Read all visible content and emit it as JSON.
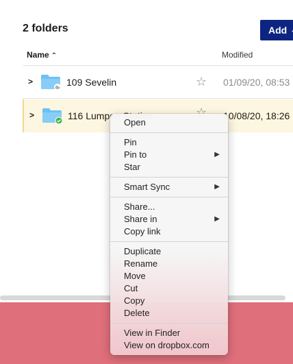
{
  "header": {
    "title": "2 folders",
    "add_label": "Add",
    "add_chevron": "⌄"
  },
  "columns": {
    "name": "Name",
    "name_sort": "⌃",
    "modified": "Modified"
  },
  "rows": [
    {
      "name": "109 Sevelin",
      "modified": "01/09/20, 08:53",
      "starred": false,
      "status": "cloud"
    },
    {
      "name": "116 Lumpen Station",
      "modified": "10/08/20, 18:26",
      "starred": false,
      "status": "synced"
    }
  ],
  "context_menu": {
    "groups": [
      [
        {
          "label": "Open"
        }
      ],
      [
        {
          "label": "Pin"
        },
        {
          "label": "Pin to",
          "submenu": "▶"
        },
        {
          "label": "Star"
        }
      ],
      [
        {
          "label": "Smart Sync",
          "submenu": "▶"
        }
      ],
      [
        {
          "label": "Share..."
        },
        {
          "label": "Share in",
          "submenu": "▶"
        },
        {
          "label": "Copy link"
        }
      ],
      [
        {
          "label": "Duplicate"
        },
        {
          "label": "Rename"
        },
        {
          "label": "Move"
        },
        {
          "label": "Cut"
        },
        {
          "label": "Copy"
        },
        {
          "label": "Delete"
        }
      ],
      [
        {
          "label": "View in Finder"
        },
        {
          "label": "View on dropbox.com"
        }
      ]
    ]
  },
  "icons": {
    "expand": "chevron-right-icon",
    "star": "star-icon",
    "folder": "folder-icon",
    "cloud_badge": "cloud-icon",
    "check_badge": "check-icon",
    "sort": "sort-ascending-icon"
  },
  "colors": {
    "accent": "#0d2481",
    "folder": "#6dc1f5",
    "synced": "#3bb54a",
    "selected_row": "#fdf6e0"
  }
}
